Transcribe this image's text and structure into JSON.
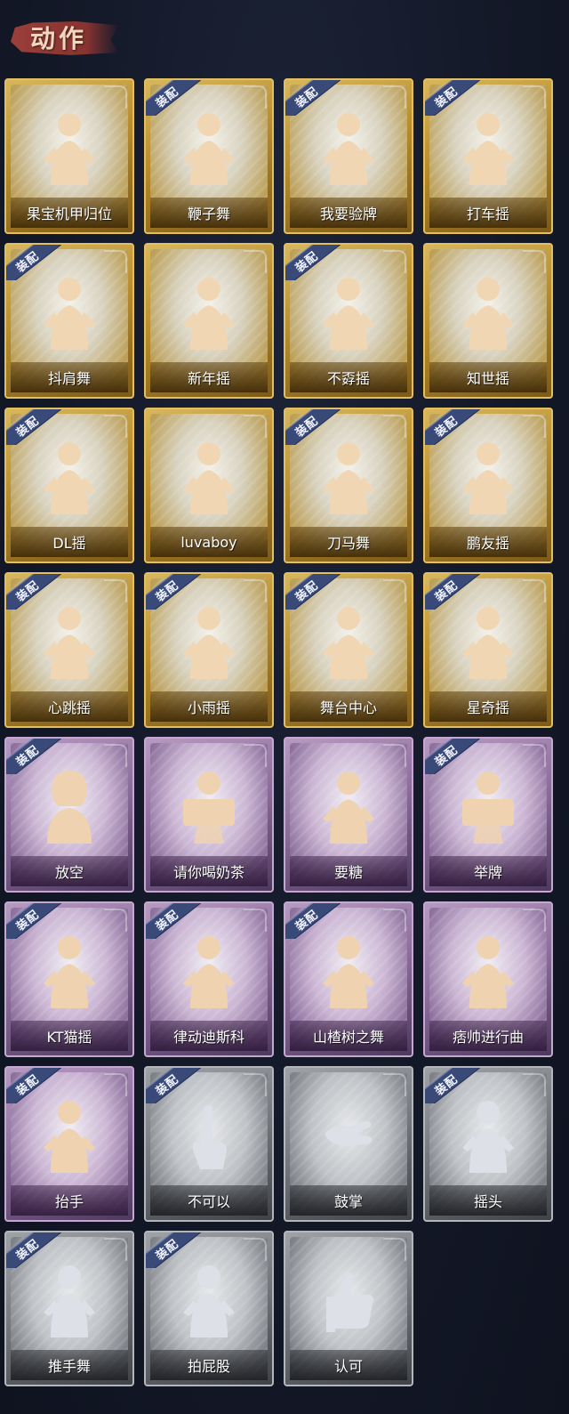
{
  "header": {
    "title": "动作"
  },
  "badge_text": "装配",
  "colors": {
    "background": "#141a29",
    "header_brush": "#a2413b",
    "badge": "#3a4a78",
    "gold_tier": "#c9a13f",
    "purple_tier": "#9a7aab",
    "silver_tier": "#8c8f95"
  },
  "emotes": [
    {
      "label": "果宝机甲归位",
      "tier": "gold",
      "equipped": false,
      "icon": "figure-icon"
    },
    {
      "label": "鞭子舞",
      "tier": "gold",
      "equipped": true,
      "icon": "figure-icon"
    },
    {
      "label": "我要验牌",
      "tier": "gold",
      "equipped": true,
      "icon": "figure-icon"
    },
    {
      "label": "打车摇",
      "tier": "gold",
      "equipped": true,
      "icon": "figure-icon"
    },
    {
      "label": "抖肩舞",
      "tier": "gold",
      "equipped": true,
      "icon": "figure-icon"
    },
    {
      "label": "新年摇",
      "tier": "gold",
      "equipped": false,
      "icon": "figure-icon"
    },
    {
      "label": "不孬摇",
      "tier": "gold",
      "equipped": true,
      "icon": "figure-icon"
    },
    {
      "label": "知世摇",
      "tier": "gold",
      "equipped": false,
      "icon": "figure-icon"
    },
    {
      "label": "DL摇",
      "tier": "gold",
      "equipped": true,
      "icon": "figure-icon"
    },
    {
      "label": "luvaboy",
      "tier": "gold",
      "equipped": false,
      "icon": "figure-icon"
    },
    {
      "label": "刀马舞",
      "tier": "gold",
      "equipped": true,
      "icon": "figure-icon"
    },
    {
      "label": "鹏友摇",
      "tier": "gold",
      "equipped": true,
      "icon": "figure-icon"
    },
    {
      "label": "心跳摇",
      "tier": "gold",
      "equipped": true,
      "icon": "figure-icon"
    },
    {
      "label": "小雨摇",
      "tier": "gold",
      "equipped": true,
      "icon": "figure-icon"
    },
    {
      "label": "舞台中心",
      "tier": "gold",
      "equipped": true,
      "icon": "figure-icon"
    },
    {
      "label": "星奇摇",
      "tier": "gold",
      "equipped": true,
      "icon": "figure-icon"
    },
    {
      "label": "放空",
      "tier": "purple",
      "equipped": true,
      "icon": "hooded-figure-icon"
    },
    {
      "label": "请你喝奶茶",
      "tier": "purple",
      "equipped": false,
      "icon": "sign-figure-icon"
    },
    {
      "label": "要糖",
      "tier": "purple",
      "equipped": false,
      "icon": "figure-icon"
    },
    {
      "label": "举牌",
      "tier": "purple",
      "equipped": true,
      "icon": "sign-figure-icon"
    },
    {
      "label": "KT猫摇",
      "tier": "purple",
      "equipped": true,
      "icon": "figure-icon"
    },
    {
      "label": "律动迪斯科",
      "tier": "purple",
      "equipped": true,
      "icon": "figure-icon"
    },
    {
      "label": "山楂树之舞",
      "tier": "purple",
      "equipped": true,
      "icon": "figure-icon"
    },
    {
      "label": "痞帅进行曲",
      "tier": "purple",
      "equipped": false,
      "icon": "figure-icon"
    },
    {
      "label": "抬手",
      "tier": "purple",
      "equipped": true,
      "icon": "figure-icon"
    },
    {
      "label": "不可以",
      "tier": "silver",
      "equipped": true,
      "icon": "hand-icon"
    },
    {
      "label": "鼓掌",
      "tier": "silver",
      "equipped": false,
      "icon": "clap-icon"
    },
    {
      "label": "摇头",
      "tier": "silver",
      "equipped": true,
      "icon": "figure-icon"
    },
    {
      "label": "推手舞",
      "tier": "silver",
      "equipped": true,
      "icon": "figure-icon"
    },
    {
      "label": "拍屁股",
      "tier": "silver",
      "equipped": true,
      "icon": "figure-icon"
    },
    {
      "label": "认可",
      "tier": "silver",
      "equipped": false,
      "icon": "thumbs-up-icon"
    }
  ]
}
